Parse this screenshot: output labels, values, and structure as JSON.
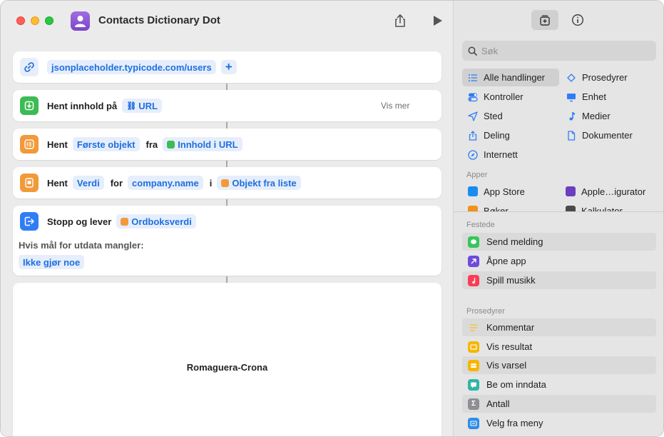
{
  "window": {
    "title": "Contacts Dictionary Dot"
  },
  "editor": {
    "url_block": {
      "url": "jsonplaceholder.typicode.com/users",
      "add": "+"
    },
    "get_contents": {
      "label": "Hent innhold på",
      "token": "URL",
      "more": "Vis mer"
    },
    "get_first": {
      "label": "Hent",
      "token_item": "Første objekt",
      "from": "fra",
      "token_source": "Innhold i URL"
    },
    "get_value": {
      "label": "Hent",
      "token_kind": "Verdi",
      "for": "for",
      "token_key": "company.name",
      "in": "i",
      "token_source": "Objekt fra liste"
    },
    "stop": {
      "label": "Stopp og lever",
      "token": "Ordboksverdi",
      "fallback_label": "Hvis mål for utdata mangler:",
      "fallback_value": "Ikke gjør noe"
    },
    "result": {
      "text": "Romaguera-Crona"
    }
  },
  "sidebar": {
    "search_placeholder": "Søk",
    "categories": [
      {
        "label": "Alle handlinger",
        "icon": "list-icon",
        "selected": true
      },
      {
        "label": "Prosedyrer",
        "icon": "flow-icon"
      },
      {
        "label": "Kontroller",
        "icon": "toggle-icon"
      },
      {
        "label": "Enhet",
        "icon": "monitor-icon"
      },
      {
        "label": "Sted",
        "icon": "location-arrow-icon"
      },
      {
        "label": "Medier",
        "icon": "music-note-icon"
      },
      {
        "label": "Deling",
        "icon": "share-icon"
      },
      {
        "label": "Dokumenter",
        "icon": "document-icon"
      },
      {
        "label": "Internett",
        "icon": "compass-icon"
      }
    ],
    "apps_header": "Apper",
    "apps": [
      {
        "label": "App Store",
        "color": "#1a8cf0"
      },
      {
        "label": "Apple…igurator",
        "color": "#6b3fbf"
      },
      {
        "label": "Bøker",
        "color": "#f0921c"
      },
      {
        "label": "Kalkulator",
        "color": "#4a4a4a"
      }
    ],
    "pinned_header": "Festede",
    "pinned": [
      {
        "label": "Send melding",
        "color": "#34c759"
      },
      {
        "label": "Åpne app",
        "color": "#6e4bd8"
      },
      {
        "label": "Spill musikk",
        "color": "#fa3c55"
      }
    ],
    "procedures_header": "Prosedyrer",
    "procedures": [
      {
        "label": "Kommentar",
        "color": "#f6c343"
      },
      {
        "label": "Vis resultat",
        "color": "#f7b500"
      },
      {
        "label": "Vis varsel",
        "color": "#f7b500"
      },
      {
        "label": "Be om inndata",
        "color": "#2fb5a6"
      },
      {
        "label": "Antall",
        "color": "#8e8e93"
      },
      {
        "label": "Velg fra meny",
        "color": "#2f8ee8"
      }
    ]
  }
}
